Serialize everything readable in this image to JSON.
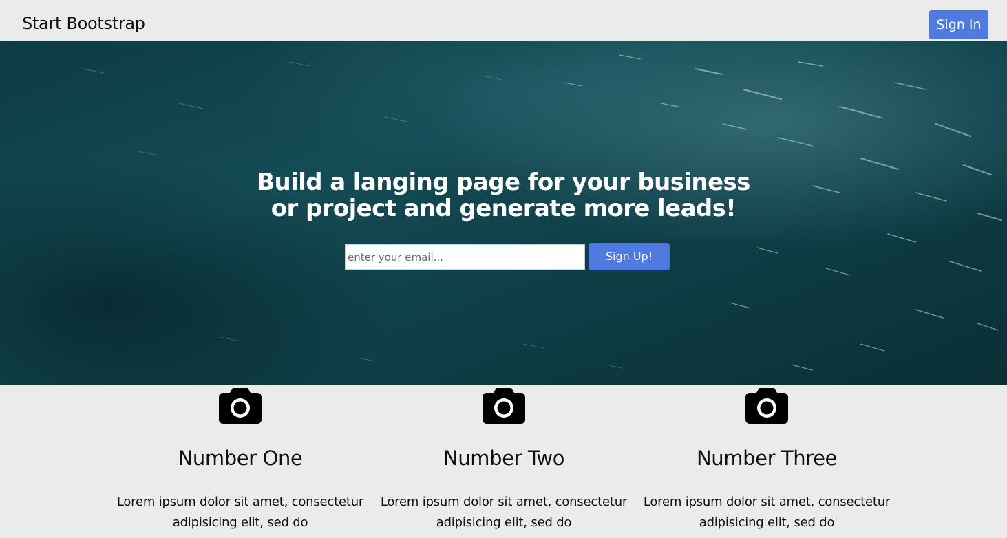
{
  "navbar": {
    "brand": "Start Bootstrap",
    "signin_label": "Sign In"
  },
  "hero": {
    "title_line1": "Build a langing page for your business",
    "title_line2": "or project and generate more leads!",
    "email_placeholder": "enter your email...",
    "signup_label": "Sign Up!"
  },
  "features": [
    {
      "icon": "camera-icon",
      "title": "Number One",
      "text": "Lorem ipsum dolor sit amet, consectetur adipisicing elit, sed do"
    },
    {
      "icon": "camera-icon",
      "title": "Number Two",
      "text": "Lorem ipsum dolor sit amet, consectetur adipisicing elit, sed do"
    },
    {
      "icon": "camera-icon",
      "title": "Number Three",
      "text": "Lorem ipsum dolor sit amet, consectetur adipisicing elit, sed do"
    }
  ],
  "colors": {
    "accent": "#4f7adf",
    "page_background": "#ebebeb",
    "hero_water": "#0f3f48"
  }
}
